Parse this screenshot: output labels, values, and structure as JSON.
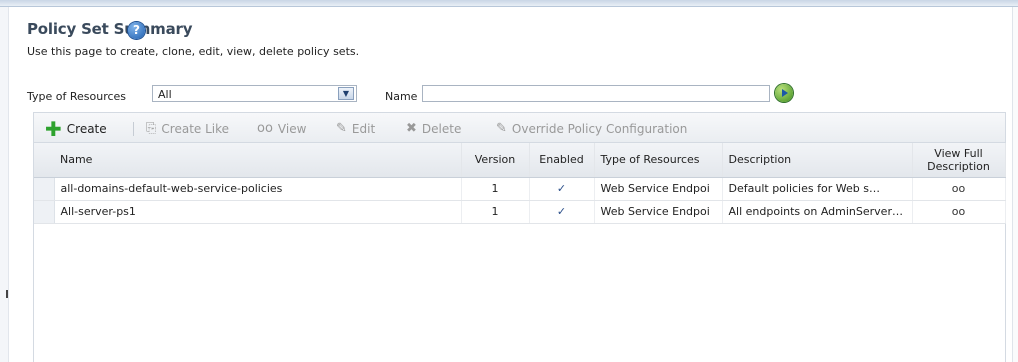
{
  "page": {
    "title": "Policy Set Summary",
    "subtitle": "Use this page to create, clone, edit, view, delete policy sets."
  },
  "filters": {
    "type_label": "Type of Resources",
    "type_value": "All",
    "name_label": "Name",
    "name_value": ""
  },
  "toolbar": {
    "create": "Create",
    "create_like": "Create Like",
    "view": "View",
    "edit": "Edit",
    "delete": "Delete",
    "override": "Override Policy Configuration"
  },
  "table": {
    "columns": {
      "name": "Name",
      "version": "Version",
      "enabled": "Enabled",
      "type": "Type of Resources",
      "description": "Description",
      "view_full_1": "View Full",
      "view_full_2": "Description"
    },
    "rows": [
      {
        "name": "all-domains-default-web-service-policies",
        "version": "1",
        "enabled": "✓",
        "type": "Web Service Endpoi",
        "description": "Default policies for Web s…"
      },
      {
        "name": "All-server-ps1",
        "version": "1",
        "enabled": "✓",
        "type": "Web Service Endpoi",
        "description": "All endpoints on AdminServer…"
      }
    ]
  },
  "icons": {
    "help": "?",
    "dropdown": "▼",
    "create": "✚",
    "create_like": "⎘",
    "view": "ᴏᴏ",
    "edit": "✎",
    "delete": "✖",
    "override": "✎",
    "view_full": "ᴏᴏ"
  }
}
